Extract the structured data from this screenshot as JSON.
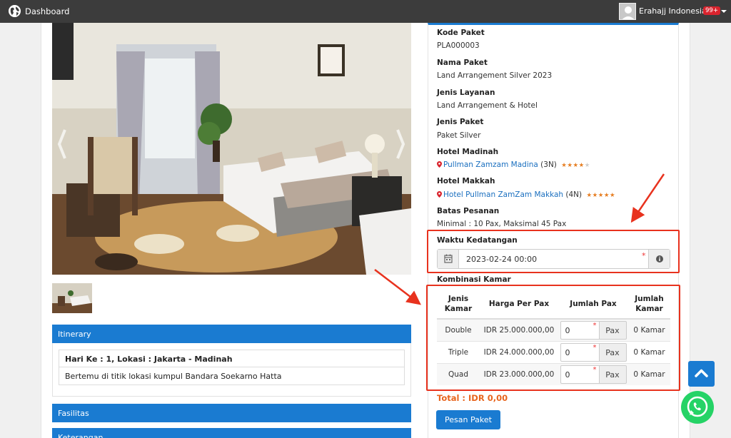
{
  "topbar": {
    "brand": "Dashboard",
    "user": "Erahajj Indonesia",
    "badge": "99+"
  },
  "panels": {
    "itinerary": "Itinerary",
    "fasilitas": "Fasilitas",
    "keterangan": "Keterangan"
  },
  "itinerary": {
    "day": "Hari Ke : 1, Lokasi : Jakarta - Madinah",
    "desc": "Bertemu di titik lokasi kumpul Bandara Soekarno Hatta"
  },
  "details": {
    "kode_label": "Kode Paket",
    "kode": "PLA000003",
    "nama_label": "Nama Paket",
    "nama": "Land Arrangement Silver 2023",
    "layanan_label": "Jenis Layanan",
    "layanan": "Land Arrangement & Hotel",
    "jenis_label": "Jenis Paket",
    "jenis": "Paket Silver",
    "madinah_label": "Hotel Madinah",
    "madinah_hotel": "Pullman Zamzam Madina",
    "madinah_nights": "(3N)",
    "makkah_label": "Hotel Makkah",
    "makkah_hotel": "Hotel Pullman ZamZam Makkah",
    "makkah_nights": "(4N)",
    "batas_label": "Batas Pesanan",
    "batas": "Minimal : 10 Pax, Maksimal 45 Pax"
  },
  "ratings": {
    "madinah_stars": 4,
    "makkah_stars": 5
  },
  "kedatangan": {
    "label": "Waktu Kedatangan",
    "value": "2023-02-24 00:00"
  },
  "kamar": {
    "label": "Kombinasi Kamar",
    "headers": {
      "jenis": "Jenis Kamar",
      "harga": "Harga Per Pax",
      "jumlah_pax": "Jumlah Pax",
      "jumlah_kamar": "Jumlah Kamar"
    },
    "rows": [
      {
        "jenis": "Double",
        "harga": "IDR 25.000.000,00",
        "pax": "0",
        "unit": "Pax",
        "kamar": "0 Kamar"
      },
      {
        "jenis": "Triple",
        "harga": "IDR 24.000.000,00",
        "pax": "0",
        "unit": "Pax",
        "kamar": "0 Kamar"
      },
      {
        "jenis": "Quad",
        "harga": "IDR 23.000.000,00",
        "pax": "0",
        "unit": "Pax",
        "kamar": "0 Kamar"
      }
    ]
  },
  "total": "Total : IDR 0,00",
  "pesan_button": "Pesan Paket",
  "colors": {
    "primary": "#1a7bd1",
    "highlight": "#e8321e",
    "total": "#e8651e",
    "whatsapp": "#25d366"
  }
}
